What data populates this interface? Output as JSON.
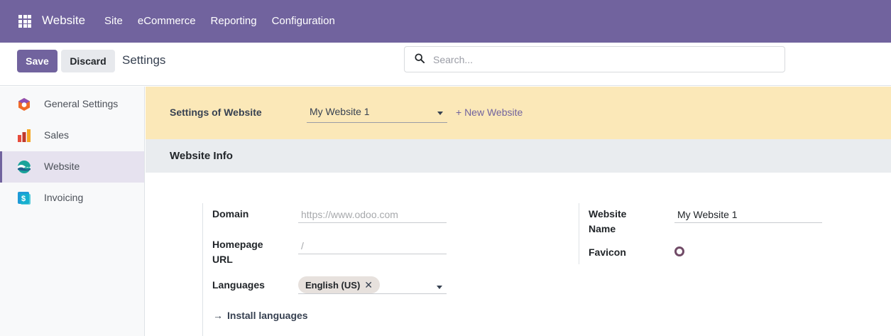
{
  "navbar": {
    "brand": "Website",
    "menu": [
      "Site",
      "eCommerce",
      "Reporting",
      "Configuration"
    ]
  },
  "control_panel": {
    "save_label": "Save",
    "discard_label": "Discard",
    "title": "Settings",
    "search_placeholder": "Search..."
  },
  "sidebar": {
    "items": [
      {
        "label": "General Settings",
        "icon": "odoo-hexagon-icon"
      },
      {
        "label": "Sales",
        "icon": "sales-chart-icon"
      },
      {
        "label": "Website",
        "icon": "website-globe-icon",
        "active": true
      },
      {
        "label": "Invoicing",
        "icon": "invoice-dollar-icon"
      }
    ]
  },
  "website_settings": {
    "label": "Settings of Website",
    "selected": "My Website 1",
    "new_website": "+ New Website"
  },
  "website_info": {
    "title": "Website Info",
    "domain_label": "Domain",
    "domain_placeholder": "https://www.odoo.com",
    "homepage_label": "Homepage URL",
    "homepage_placeholder": "/",
    "languages_label": "Languages",
    "language_tag": "English (US)",
    "install_languages": "Install languages",
    "website_name_label": "Website Name",
    "website_name_value": "My Website 1",
    "favicon_label": "Favicon"
  },
  "colors": {
    "navbar": "#71639e",
    "primary": "#71639e",
    "website_bar": "#fbe8b8",
    "section_header": "#e9ecef"
  }
}
